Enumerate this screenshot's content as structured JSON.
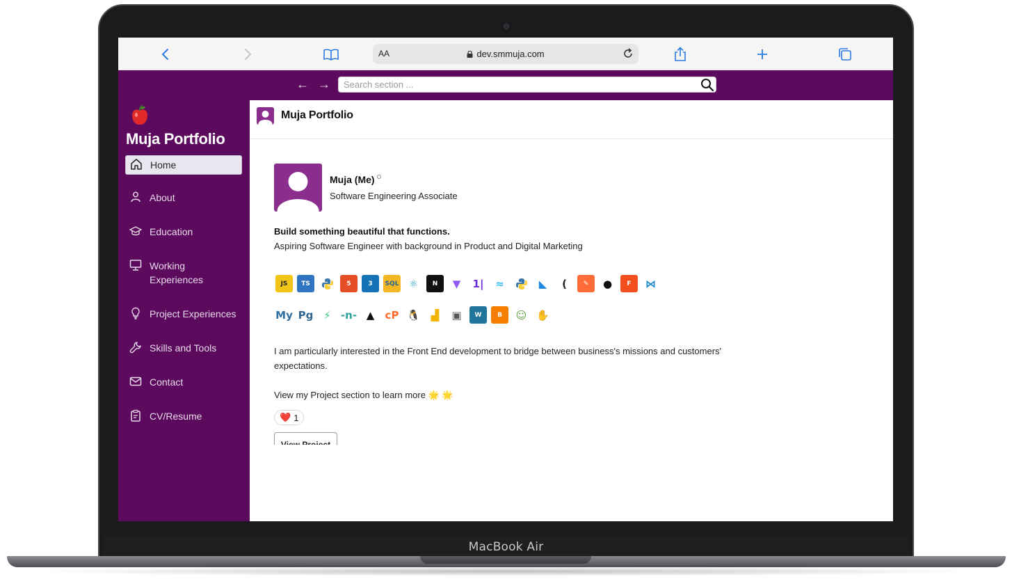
{
  "device": {
    "label": "MacBook Air"
  },
  "browser": {
    "reader_label": "AA",
    "url": "dev.smmuja.com"
  },
  "app": {
    "search_placeholder": "Search section ...",
    "brand_title": "Muja Portfolio",
    "header_title": "Muja Portfolio"
  },
  "sidebar": {
    "items": [
      {
        "label": "Home",
        "icon": "home-icon",
        "active": true
      },
      {
        "label": "About",
        "icon": "person-icon"
      },
      {
        "label": "Education",
        "icon": "graduation-cap-icon"
      },
      {
        "label": "Working Experiences",
        "icon": "monitor-icon"
      },
      {
        "label": "Project Experiences",
        "icon": "lightbulb-icon"
      },
      {
        "label": "Skills and Tools",
        "icon": "wrench-icon"
      },
      {
        "label": "Contact",
        "icon": "mail-icon"
      },
      {
        "label": "CV/Resume",
        "icon": "clipboard-icon"
      }
    ]
  },
  "profile": {
    "name": "Muja (Me)",
    "role": "Software Engineering Associate",
    "tagline": "Build something beautiful that functions.",
    "description": "Aspiring Software Engineer with background in Product and Digital Marketing",
    "interest": "I am particularly interested in the Front End development to bridge between business's missions and customers' expectations.",
    "view_more": "View my Project section to learn more 🌟 🌟",
    "reaction_emoji": "❤️",
    "reaction_count": "1",
    "view_project_label": "View Project"
  },
  "tech_icons_row1": [
    {
      "name": "javascript-icon",
      "text": "JS",
      "bg": "#f0c419",
      "fg": "#222"
    },
    {
      "name": "typescript-icon",
      "text": "TS",
      "bg": "#2f74c0",
      "fg": "#fff"
    },
    {
      "name": "python-icon",
      "text": "",
      "bg": "#3572a5",
      "fg": "#ffd43b"
    },
    {
      "name": "html5-icon",
      "text": "5",
      "bg": "#e44d26",
      "fg": "#fff"
    },
    {
      "name": "css3-icon",
      "text": "3",
      "bg": "#1572b6",
      "fg": "#fff"
    },
    {
      "name": "sql-icon",
      "text": "SQL",
      "bg": "#f3b721",
      "fg": "#1f5f9e"
    },
    {
      "name": "react-icon",
      "text": "⚛",
      "bg": "#ffffff",
      "fg": "#3aa6c6"
    },
    {
      "name": "nextjs-icon",
      "text": "N",
      "bg": "#111111",
      "fg": "#fff"
    },
    {
      "name": "vite-icon",
      "text": "▼",
      "bg": "#ffffff",
      "fg": "#8f5bf3"
    },
    {
      "name": "turborepo-icon",
      "text": "1|",
      "bg": "#ffffff",
      "fg": "#6a2bd9"
    },
    {
      "name": "tailwind-icon",
      "text": "≈",
      "bg": "#ffffff",
      "fg": "#38bdf8"
    },
    {
      "name": "python2-icon",
      "text": "",
      "bg": "#3572a5",
      "fg": "#ffd43b"
    },
    {
      "name": "bootstrap-icon",
      "text": "◣",
      "bg": "#ffffff",
      "fg": "#1e88e5"
    },
    {
      "name": "flask-icon",
      "text": "(",
      "bg": "#ffffff",
      "fg": "#222"
    },
    {
      "name": "postman-icon",
      "text": "✎",
      "bg": "#ff6c37",
      "fg": "#fff"
    },
    {
      "name": "github-icon",
      "text": "●",
      "bg": "#ffffff",
      "fg": "#111"
    },
    {
      "name": "figma-icon",
      "text": "F",
      "bg": "#f24e1e",
      "fg": "#fff"
    },
    {
      "name": "vscode-icon",
      "text": "⋈",
      "bg": "#ffffff",
      "fg": "#1f8ad2"
    }
  ],
  "tech_icons_row2": [
    {
      "name": "mysql-icon",
      "text": "My",
      "bg": "#ffffff",
      "fg": "#2f6fa0"
    },
    {
      "name": "postgresql-icon",
      "text": "Pg",
      "bg": "#ffffff",
      "fg": "#336791"
    },
    {
      "name": "supabase-icon",
      "text": "⚡",
      "bg": "#ffffff",
      "fg": "#3ecf8e"
    },
    {
      "name": "n8n-icon",
      "text": "-n-",
      "bg": "#ffffff",
      "fg": "#2ea39b"
    },
    {
      "name": "vercel-icon",
      "text": "▲",
      "bg": "#ffffff",
      "fg": "#111"
    },
    {
      "name": "cpanel-icon",
      "text": "cP",
      "bg": "#ffffff",
      "fg": "#ff6c2c"
    },
    {
      "name": "linux-icon",
      "text": "🐧",
      "bg": "#ffffff",
      "fg": "#111"
    },
    {
      "name": "google-analytics-icon",
      "text": "▟",
      "bg": "#ffffff",
      "fg": "#f4b400"
    },
    {
      "name": "tag-manager-icon",
      "text": "▣",
      "bg": "#ffffff",
      "fg": "#555"
    },
    {
      "name": "wordpress-icon",
      "text": "W",
      "bg": "#21759b",
      "fg": "#fff"
    },
    {
      "name": "blogger-icon",
      "text": "B",
      "bg": "#f57d00",
      "fg": "#fff"
    },
    {
      "name": "presenter-icon",
      "text": "☺",
      "bg": "#ffffff",
      "fg": "#5a9e3a"
    },
    {
      "name": "handshake-icon",
      "text": "✋",
      "bg": "#ffffff",
      "fg": "#e8625a"
    }
  ]
}
